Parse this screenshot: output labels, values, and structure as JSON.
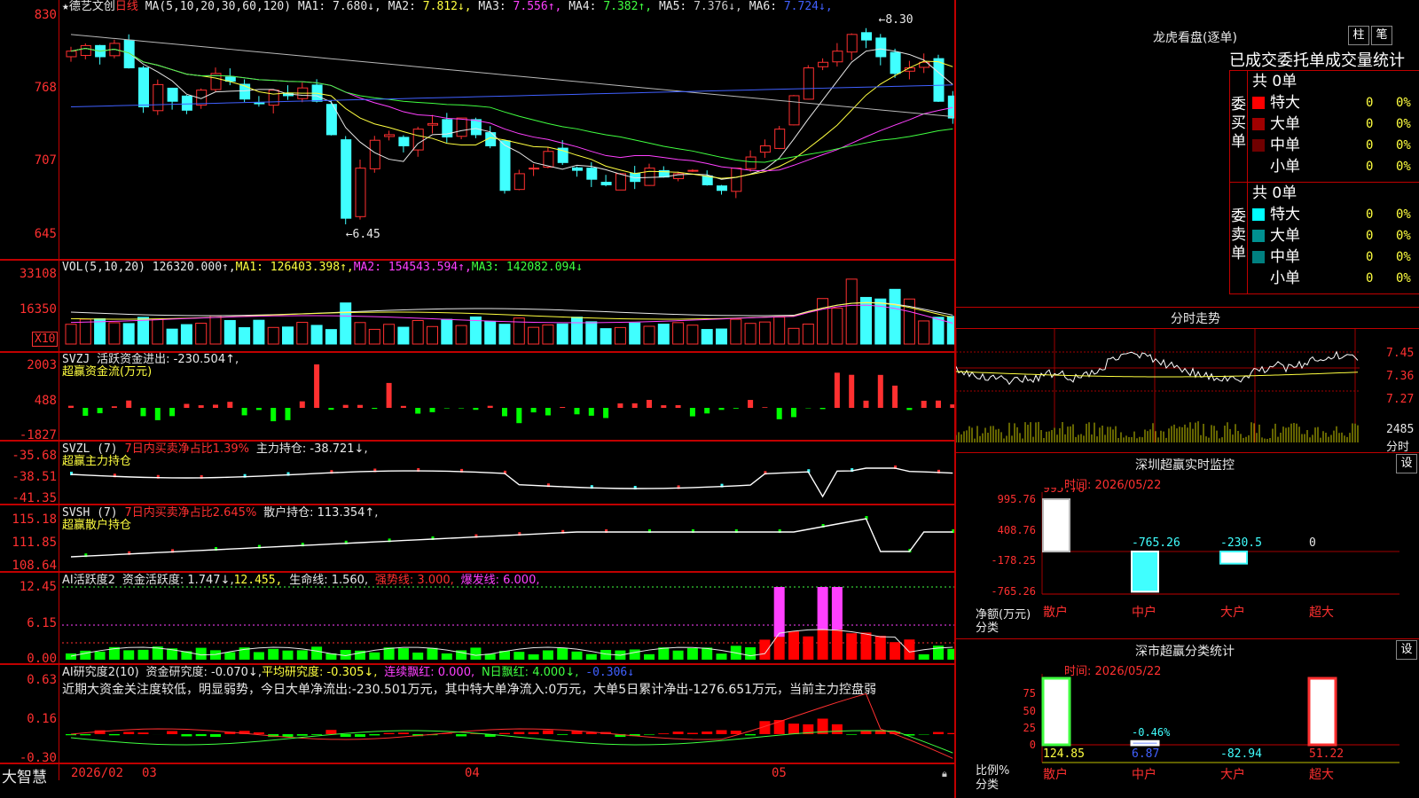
{
  "header": {
    "star": "★",
    "stock_name": "德艺文创",
    "period": "日线",
    "ma_params": "MA(5,10,20,30,60,120)",
    "ma": [
      {
        "label": "MA1:",
        "value": "7.680↓",
        "color": "#e8e8e8"
      },
      {
        "label": "MA2:",
        "value": "7.812↓",
        "color": "#ffff40"
      },
      {
        "label": "MA3:",
        "value": "7.556↑",
        "color": "#ff40ff"
      },
      {
        "label": "MA4:",
        "value": "7.382↑",
        "color": "#40ff40"
      },
      {
        "label": "MA5:",
        "value": "7.376↓",
        "color": "#c8c8c8"
      },
      {
        "label": "MA6:",
        "value": "7.724↓",
        "color": "#4060ff"
      }
    ]
  },
  "price_panel": {
    "y_labels": [
      "830",
      "768",
      "707",
      "645"
    ],
    "high_marker": "8.30",
    "low_marker": "6.45"
  },
  "vol_panel": {
    "title": "VOL(5,10,20)",
    "value": "126320.000↑,",
    "ma1": "MA1: 126403.398↑,",
    "ma2": "MA2: 154543.594↑,",
    "ma3": "MA3: 142082.094↓",
    "y_labels": [
      "33108",
      "16350"
    ],
    "unit": "X10"
  },
  "svzj_panel": {
    "title": "SVZJ",
    "label": "活跃资金进出: -230.504↑,",
    "sub": "超赢资金流(万元)",
    "y_labels": [
      "2003",
      "488",
      "-1827"
    ]
  },
  "svzl_panel": {
    "title": "SVZL (7)",
    "ratio": "7日内买卖净占比1.39%",
    "hold": "主力持仓: -38.721↓,",
    "sub": "超赢主力持仓",
    "y_labels": [
      "-35.68",
      "-38.51",
      "-41.35"
    ]
  },
  "svsh_panel": {
    "title": "SVSH (7)",
    "ratio": "7日内买卖净占比2.645%",
    "hold": "散户持仓: 113.354↑,",
    "sub": "超赢散户持仓",
    "y_labels": [
      "115.18",
      "111.85",
      "108.64"
    ]
  },
  "ai_active_panel": {
    "title": "AI活跃度2",
    "active": "资金活跃度: 1.747↓,",
    "v2": "12.455,",
    "life": "生命线: 1.560,",
    "strong": "强势线: 3.000,",
    "burst": "爆发线: 6.000,",
    "y_labels": [
      "12.45",
      "6.15",
      "0.00"
    ]
  },
  "ai_research_panel": {
    "title": "AI研究度2(10)",
    "research": "资金研究度: -0.070↓,",
    "avg": "平均研究度: -0.305↓,",
    "cont": "连续飘红: 0.000,",
    "nday": "N日飘红: 4.000↓,",
    "last": "-0.306↓",
    "comment": "近期大资金关注度较低，明显弱势，今日大单净流出:-230.501万元，其中特大单净流入:0万元，大单5日累计净出-1276.651万元，当前主力控盘弱",
    "y_labels": [
      "0.63",
      "0.16",
      "-0.30"
    ]
  },
  "x_axis": {
    "brand": "大智慧",
    "labels": [
      "2026/02",
      "03",
      "04",
      "05"
    ]
  },
  "right": {
    "lhb_title": "龙虎看盘(逐单)",
    "btn_bar": "柱",
    "btn_pen": "笔",
    "tabs": [
      "已成交",
      "委托单",
      "成交量统计"
    ],
    "buy_side": {
      "label": "委买单",
      "total": "共 0单",
      "rows": [
        {
          "name": "特大",
          "count": "0",
          "pct": "0%",
          "color": "#ff0000"
        },
        {
          "name": "大单",
          "count": "0",
          "pct": "0%",
          "color": "#a00000"
        },
        {
          "name": "中单",
          "count": "0",
          "pct": "0%",
          "color": "#700000"
        },
        {
          "name": "小单",
          "count": "0",
          "pct": "0%",
          "color": ""
        }
      ]
    },
    "sell_side": {
      "label": "委卖单",
      "total": "共 0单",
      "rows": [
        {
          "name": "特大",
          "count": "0",
          "pct": "0%",
          "color": "#00ffff"
        },
        {
          "name": "大单",
          "count": "0",
          "pct": "0%",
          "color": "#009090"
        },
        {
          "name": "中单",
          "count": "0",
          "pct": "0%",
          "color": "#008080"
        },
        {
          "name": "小单",
          "count": "0",
          "pct": "0%",
          "color": ""
        }
      ]
    },
    "fs_title": "分时走势",
    "fs_prices": [
      "7.45",
      "7.36",
      "7.27"
    ],
    "fs_vol": [
      "2485",
      "分时"
    ],
    "sz_monitor": {
      "title": "深圳超赢实时监控",
      "btn": "设",
      "time": "时间: 2026/05/22",
      "y_labels": [
        "995.76",
        "408.76",
        "-178.25",
        "-765.26"
      ],
      "unit": "净额(万元)",
      "cat_label": "分类",
      "categories": [
        "散户",
        "中户",
        "大户",
        "超大"
      ],
      "values": [
        995.76,
        -765.26,
        -230.5,
        0
      ],
      "value_labels": [
        "995.76",
        "-765.26",
        "-230.5",
        "0"
      ]
    },
    "sz_class": {
      "title": "深市超赢分类统计",
      "btn": "设",
      "time": "时间: 2026/05/22",
      "y_labels": [
        "75",
        "50",
        "25",
        "0"
      ],
      "unit": "比例%",
      "cat_label": "分类",
      "categories": [
        "散户",
        "中户",
        "大户",
        "超大"
      ],
      "ratio_values": [
        100,
        5,
        0,
        100
      ],
      "top_label": "-0.46%",
      "value_labels": [
        "124.85",
        "6.87",
        "-82.94",
        "51.22"
      ]
    }
  }
}
